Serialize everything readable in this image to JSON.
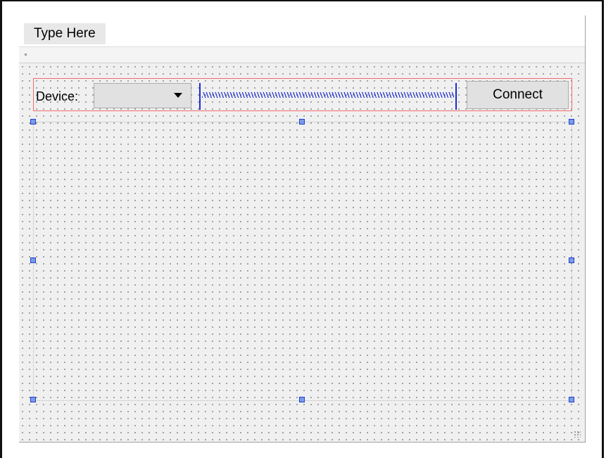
{
  "menubar": {
    "items": [
      {
        "label": "Type Here"
      }
    ]
  },
  "device_row": {
    "label": "Device:",
    "combo_value": "",
    "connect_label": "Connect"
  },
  "colors": {
    "layout_border": "#f06a6a",
    "spacer": "#1a2bd6",
    "handle_fill": "#7b9ce6",
    "handle_border": "#1f3fd1",
    "background": "#f0f0f0"
  },
  "icons": [
    "combo-arrow-icon",
    "size-grip-icon",
    "toolbar-handle-icon"
  ]
}
